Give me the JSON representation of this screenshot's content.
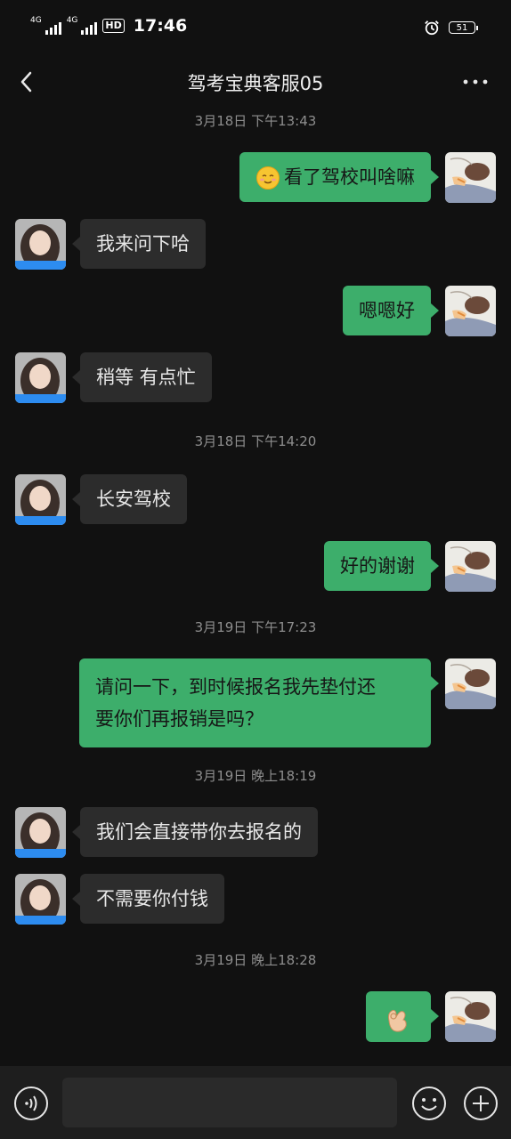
{
  "status_bar": {
    "net1": "4G",
    "net2": "4G",
    "hd": "HD",
    "time": "17:46",
    "battery": "51"
  },
  "header": {
    "title": "驾考宝典客服05"
  },
  "timestamps": [
    "3月18日 下午13:43",
    "3月18日 下午14:20",
    "3月19日 下午17:23",
    "3月19日 晚上18:19",
    "3月19日 晚上18:28"
  ],
  "messages": [
    {
      "from": "user",
      "text": "看了驾校叫啥嘛",
      "emoji": "smiling-face-emoji"
    },
    {
      "from": "agent",
      "text": "我来问下哈"
    },
    {
      "from": "user",
      "text": "嗯嗯好"
    },
    {
      "from": "agent",
      "text": "稍等 有点忙"
    },
    {
      "from": "agent",
      "text": "长安驾校"
    },
    {
      "from": "user",
      "text": "好的谢谢"
    },
    {
      "from": "user",
      "text_line1": "请问一下，到时候报名我先垫付还",
      "text_line2": "要你们再报销是吗？"
    },
    {
      "from": "agent",
      "text": "我们会直接带你去报名的"
    },
    {
      "from": "agent",
      "text": "不需要你付钱"
    },
    {
      "from": "user",
      "emoji": "ok-hand-emoji"
    }
  ],
  "agent_avatar_badge": "驾考宝典",
  "input": {
    "placeholder": ""
  },
  "colors": {
    "background": "#111111",
    "outgoing_bubble": "#3dae6b",
    "incoming_bubble": "#2c2c2c",
    "timestamp": "#8e8e8e"
  }
}
